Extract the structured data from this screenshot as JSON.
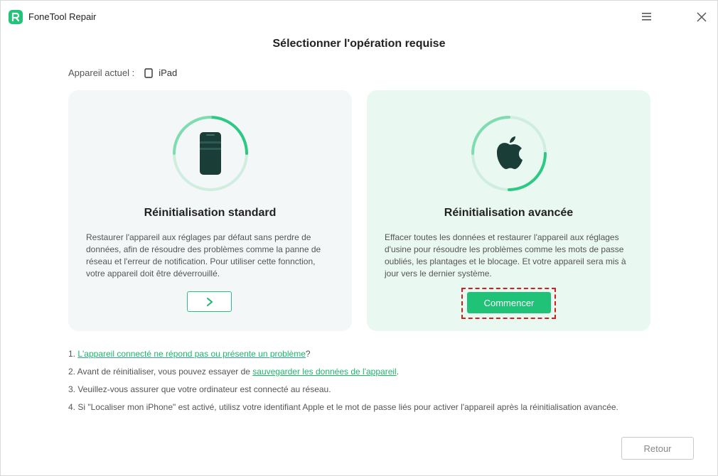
{
  "window": {
    "app_title": "FoneTool Repair"
  },
  "page": {
    "title": "Sélectionner l'opération requise",
    "device_label": "Appareil actuel :",
    "device_name": "iPad"
  },
  "cards": [
    {
      "title": "Réinitialisation standard",
      "description": "Restaurer l'appareil aux réglages par défaut sans perdre de données, afin de résoudre des problèmes comme la panne de réseau et l'erreur de notification. Pour utiliser cette fonnction, votre appareil doit être déverrouillé.",
      "button_glyph": "›"
    },
    {
      "title": "Réinitialisation avancée",
      "description": "Effacer toutes les données et restaurer l'appareil aux réglages d'usine pour résoudre les problèmes comme les mots de passe oubliés, les plantages et le blocage. Et votre appareil sera mis à jour vers le dernier système.",
      "button_label": "Commencer"
    }
  ],
  "notes": [
    {
      "prefix": "1. ",
      "link": "L'appareil connecté ne répond pas ou présente un problème",
      "suffix": "?"
    },
    {
      "prefix": "2. Avant de réinitialiser, vous pouvez essayer de ",
      "link": "sauvegarder les données de l'appareil",
      "suffix": "."
    },
    {
      "prefix": "3. Veuillez-vous assurer que votre ordinateur est connecté au réseau."
    },
    {
      "prefix": "4. Si \"Localiser mon iPhone\" est activé, utilisz votre identifiant Apple et le mot de passe liés pour activer l'appareil après la réinitialisation avancée."
    }
  ],
  "footer": {
    "back_label": "Retour"
  },
  "colors": {
    "accent": "#1fc276",
    "highlight": "#d71e1e"
  }
}
